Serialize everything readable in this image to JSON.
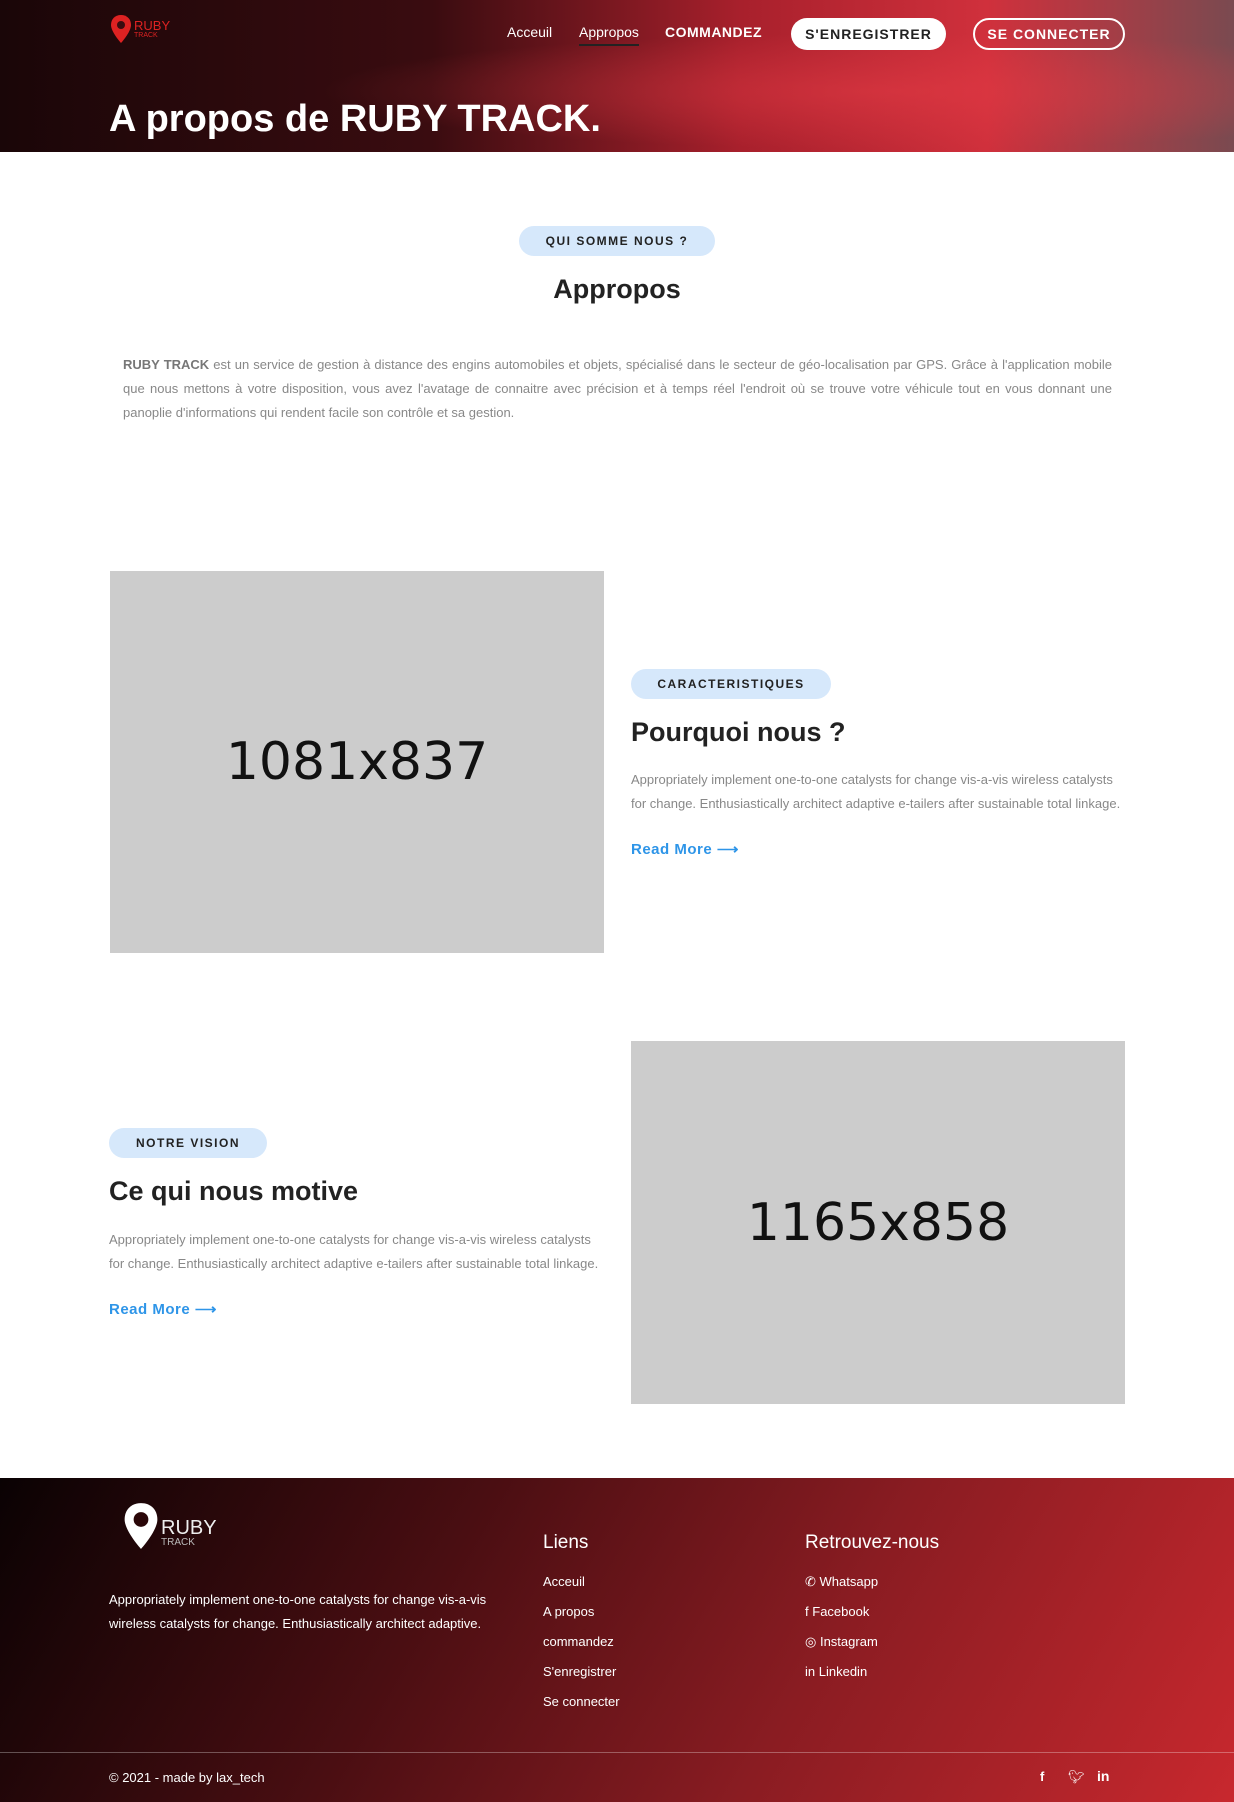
{
  "header": {
    "logo": {
      "name": "RUBY",
      "sub": "TRACK"
    },
    "nav": [
      "Acceuil",
      "Appropos",
      "COMMANDEZ"
    ],
    "register_label": "S'ENREGISTRER",
    "login_label": "SE CONNECTER",
    "title": "A propos de RUBY TRACK."
  },
  "about": {
    "badge": "QUI SOMME NOUS ?",
    "heading": "Appropos",
    "brand": "RUBY TRACK",
    "text": " est un service de gestion à distance des engins automobiles et objets, spécialisé dans le secteur de géo-localisation par GPS. Grâce à l'application mobile que nous mettons à votre disposition, vous avez l'avatage de connaitre avec précision et à temps réel l'endroit où se trouve votre véhicule tout en vous donnant une panoplie d'informations qui rendent facile son contrôle et sa gestion."
  },
  "features": {
    "image_label": "1081x837",
    "badge": "CARACTERISTIQUES",
    "heading": "Pourquoi nous ?",
    "text": "Appropriately implement one-to-one catalysts for change vis-a-vis wireless catalysts for change. Enthusiastically architect adaptive e-tailers after sustainable total linkage.",
    "read_more": "Read More ⟶"
  },
  "vision": {
    "image_label": "1165x858",
    "badge": "NOTRE VISION",
    "heading": "Ce qui nous motive",
    "text": "Appropriately implement one-to-one catalysts for change vis-a-vis wireless catalysts for change. Enthusiastically architect adaptive e-tailers after sustainable total linkage.",
    "read_more": "Read More ⟶"
  },
  "footer": {
    "logo": {
      "name": "RUBY",
      "sub": "TRACK"
    },
    "description": "Appropriately implement one-to-one catalysts for change vis-a-vis wireless catalysts for change. Enthusiastically architect adaptive.",
    "links_title": "Liens",
    "links": [
      "Acceuil",
      "A propos",
      "commandez",
      "S'enregistrer",
      "Se connecter"
    ],
    "social_title": "Retrouvez-nous",
    "social": [
      "Whatsapp",
      "Facebook",
      "Instagram",
      "Linkedin"
    ],
    "copyright": "© 2021 - made by lax_tech"
  },
  "colors": {
    "accent": "#2e95e8",
    "badge_bg": "#d6e8fb",
    "brand_red": "#c8282e"
  }
}
